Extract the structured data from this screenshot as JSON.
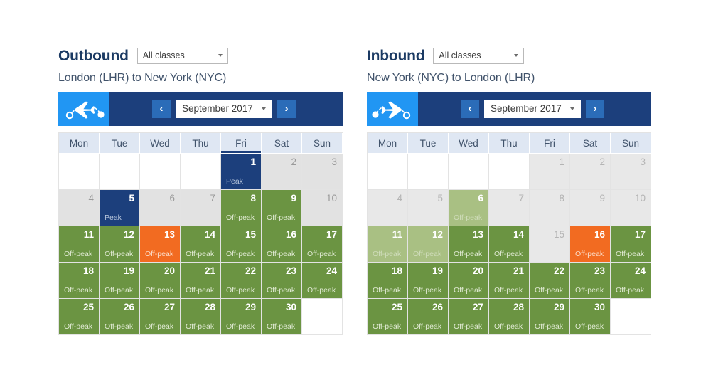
{
  "top_clipped_text": "",
  "panels": [
    {
      "key": "outbound",
      "title": "Outbound",
      "class_select": {
        "value": "All classes",
        "arrow_icon": "chevron-down-icon"
      },
      "route": "London (LHR) to New York (NYC)",
      "nav": {
        "plane_icon": "plane-outbound-icon",
        "prev_label": "‹",
        "next_label": "›",
        "month": "September 2017",
        "arrow_icon": "chevron-down-icon"
      },
      "dow": [
        "Mon",
        "Tue",
        "Wed",
        "Thu",
        "Fri",
        "Sat",
        "Sun"
      ],
      "active_dow_index": 4,
      "weeks": [
        [
          {
            "state": "empty",
            "num": "",
            "tag": ""
          },
          {
            "state": "empty",
            "num": "",
            "tag": ""
          },
          {
            "state": "empty",
            "num": "",
            "tag": ""
          },
          {
            "state": "empty",
            "num": "",
            "tag": ""
          },
          {
            "state": "peak",
            "num": "1",
            "tag": "Peak"
          },
          {
            "state": "blank",
            "num": "2",
            "tag": ""
          },
          {
            "state": "blank",
            "num": "3",
            "tag": ""
          }
        ],
        [
          {
            "state": "blank",
            "num": "4",
            "tag": ""
          },
          {
            "state": "peak",
            "num": "5",
            "tag": "Peak"
          },
          {
            "state": "blank",
            "num": "6",
            "tag": ""
          },
          {
            "state": "blank",
            "num": "7",
            "tag": ""
          },
          {
            "state": "off",
            "num": "8",
            "tag": "Off-peak"
          },
          {
            "state": "off",
            "num": "9",
            "tag": "Off-peak"
          },
          {
            "state": "blank",
            "num": "10",
            "tag": ""
          }
        ],
        [
          {
            "state": "off",
            "num": "11",
            "tag": "Off-peak"
          },
          {
            "state": "off",
            "num": "12",
            "tag": "Off-peak"
          },
          {
            "state": "selected",
            "num": "13",
            "tag": "Off-peak"
          },
          {
            "state": "off",
            "num": "14",
            "tag": "Off-peak"
          },
          {
            "state": "off",
            "num": "15",
            "tag": "Off-peak"
          },
          {
            "state": "off",
            "num": "16",
            "tag": "Off-peak"
          },
          {
            "state": "off",
            "num": "17",
            "tag": "Off-peak"
          }
        ],
        [
          {
            "state": "off",
            "num": "18",
            "tag": "Off-peak"
          },
          {
            "state": "off",
            "num": "19",
            "tag": "Off-peak"
          },
          {
            "state": "off",
            "num": "20",
            "tag": "Off-peak"
          },
          {
            "state": "off",
            "num": "21",
            "tag": "Off-peak"
          },
          {
            "state": "off",
            "num": "22",
            "tag": "Off-peak"
          },
          {
            "state": "off",
            "num": "23",
            "tag": "Off-peak"
          },
          {
            "state": "off",
            "num": "24",
            "tag": "Off-peak"
          }
        ],
        [
          {
            "state": "off",
            "num": "25",
            "tag": "Off-peak"
          },
          {
            "state": "off",
            "num": "26",
            "tag": "Off-peak"
          },
          {
            "state": "off",
            "num": "27",
            "tag": "Off-peak"
          },
          {
            "state": "off",
            "num": "28",
            "tag": "Off-peak"
          },
          {
            "state": "off",
            "num": "29",
            "tag": "Off-peak"
          },
          {
            "state": "off",
            "num": "30",
            "tag": "Off-peak"
          },
          {
            "state": "empty",
            "num": "",
            "tag": ""
          }
        ]
      ]
    },
    {
      "key": "inbound",
      "title": "Inbound",
      "class_select": {
        "value": "All classes",
        "arrow_icon": "chevron-down-icon"
      },
      "route": "New York (NYC) to London (LHR)",
      "nav": {
        "plane_icon": "plane-inbound-icon",
        "prev_label": "‹",
        "next_label": "›",
        "month": "September 2017",
        "arrow_icon": "chevron-down-icon"
      },
      "dow": [
        "Mon",
        "Tue",
        "Wed",
        "Thu",
        "Fri",
        "Sat",
        "Sun"
      ],
      "active_dow_index": -1,
      "weeks": [
        [
          {
            "state": "empty",
            "num": "",
            "tag": ""
          },
          {
            "state": "empty",
            "num": "",
            "tag": ""
          },
          {
            "state": "empty",
            "num": "",
            "tag": ""
          },
          {
            "state": "empty",
            "num": "",
            "tag": ""
          },
          {
            "state": "blank-light",
            "num": "1",
            "tag": ""
          },
          {
            "state": "blank-light",
            "num": "2",
            "tag": ""
          },
          {
            "state": "blank-light",
            "num": "3",
            "tag": ""
          }
        ],
        [
          {
            "state": "blank-light",
            "num": "4",
            "tag": ""
          },
          {
            "state": "blank-light",
            "num": "5",
            "tag": ""
          },
          {
            "state": "off-faded",
            "num": "6",
            "tag": "Off-peak"
          },
          {
            "state": "blank-light",
            "num": "7",
            "tag": ""
          },
          {
            "state": "blank-light",
            "num": "8",
            "tag": ""
          },
          {
            "state": "blank-light",
            "num": "9",
            "tag": ""
          },
          {
            "state": "blank-light",
            "num": "10",
            "tag": ""
          }
        ],
        [
          {
            "state": "off-faded",
            "num": "11",
            "tag": "Off-peak"
          },
          {
            "state": "off-faded",
            "num": "12",
            "tag": "Off-peak"
          },
          {
            "state": "off",
            "num": "13",
            "tag": "Off-peak"
          },
          {
            "state": "off",
            "num": "14",
            "tag": "Off-peak"
          },
          {
            "state": "blank-light",
            "num": "15",
            "tag": ""
          },
          {
            "state": "selected",
            "num": "16",
            "tag": "Off-peak"
          },
          {
            "state": "off",
            "num": "17",
            "tag": "Off-peak"
          }
        ],
        [
          {
            "state": "off",
            "num": "18",
            "tag": "Off-peak"
          },
          {
            "state": "off",
            "num": "19",
            "tag": "Off-peak"
          },
          {
            "state": "off",
            "num": "20",
            "tag": "Off-peak"
          },
          {
            "state": "off",
            "num": "21",
            "tag": "Off-peak"
          },
          {
            "state": "off",
            "num": "22",
            "tag": "Off-peak"
          },
          {
            "state": "off",
            "num": "23",
            "tag": "Off-peak"
          },
          {
            "state": "off",
            "num": "24",
            "tag": "Off-peak"
          }
        ],
        [
          {
            "state": "off",
            "num": "25",
            "tag": "Off-peak"
          },
          {
            "state": "off",
            "num": "26",
            "tag": "Off-peak"
          },
          {
            "state": "off",
            "num": "27",
            "tag": "Off-peak"
          },
          {
            "state": "off",
            "num": "28",
            "tag": "Off-peak"
          },
          {
            "state": "off",
            "num": "29",
            "tag": "Off-peak"
          },
          {
            "state": "off",
            "num": "30",
            "tag": "Off-peak"
          },
          {
            "state": "empty",
            "num": "",
            "tag": ""
          }
        ]
      ]
    }
  ],
  "colors": {
    "brand_dark_blue": "#1c3f7c",
    "brand_light_blue": "#2196f3",
    "off_peak_green": "#6b9442",
    "off_peak_green_faded": "#a9c083",
    "selected_orange": "#f26b21",
    "dow_header": "#dfe7f3",
    "blank_grey": "#e2e2e2"
  }
}
